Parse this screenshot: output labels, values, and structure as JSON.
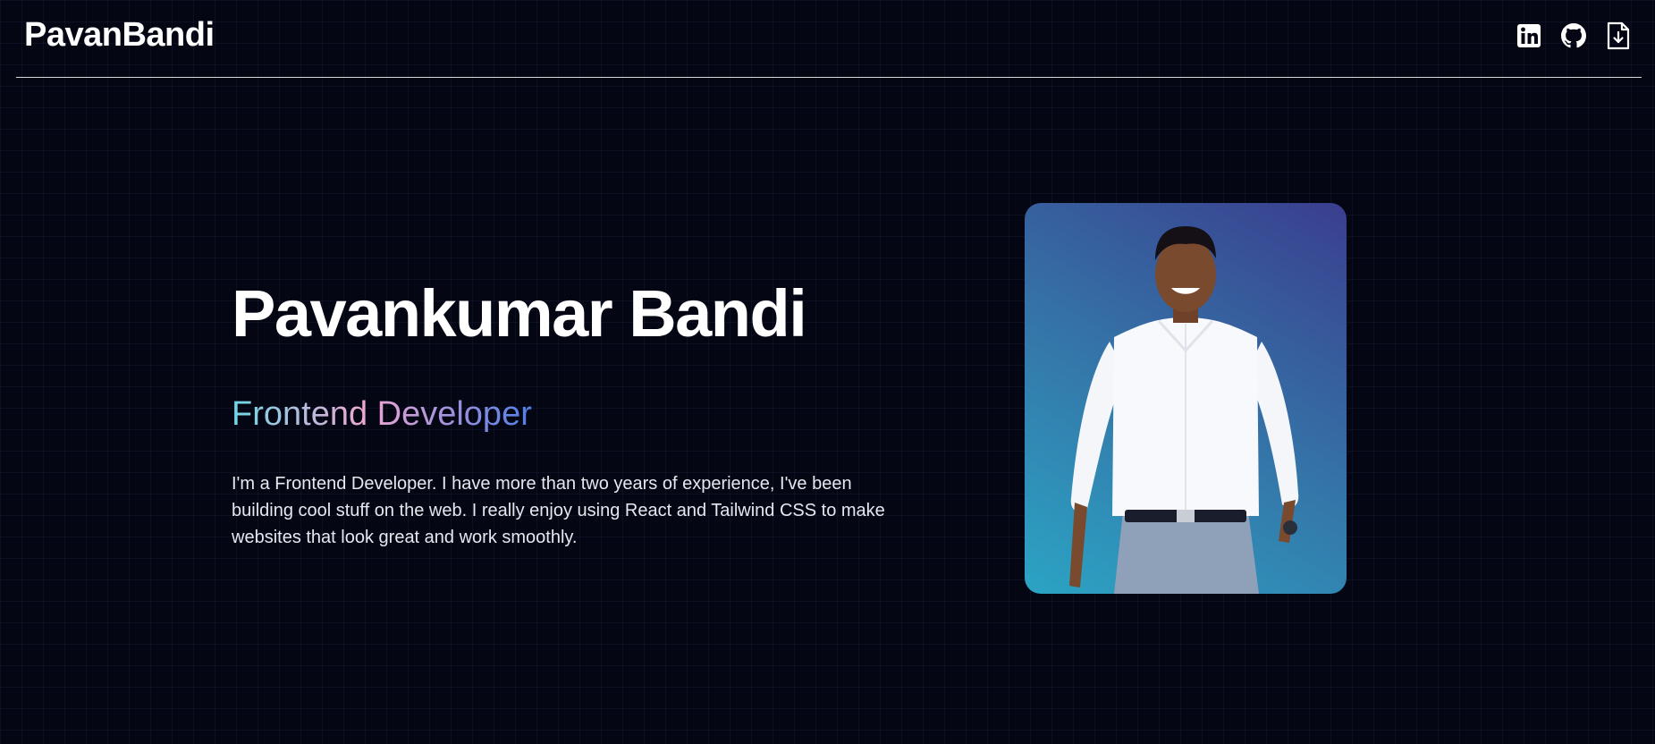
{
  "header": {
    "logo": "PavanBandi",
    "icons": [
      "linkedin-icon",
      "github-icon",
      "download-resume-icon"
    ]
  },
  "hero": {
    "name": "Pavankumar Bandi",
    "role": "Frontend Developer",
    "bio": "I'm a Frontend Developer. I have more than two years of experience, I've been building cool stuff on the web. I really enjoy using React and Tailwind CSS to make websites that look great and work smoothly."
  },
  "colors": {
    "background": "#040614",
    "text": "#ffffff",
    "role_gradient": [
      "#6fd6e6",
      "#f0a6d2",
      "#4f7fe6"
    ],
    "photo_gradient": [
      "#2ba4c4",
      "#3478aa",
      "#3a3e8e"
    ]
  }
}
